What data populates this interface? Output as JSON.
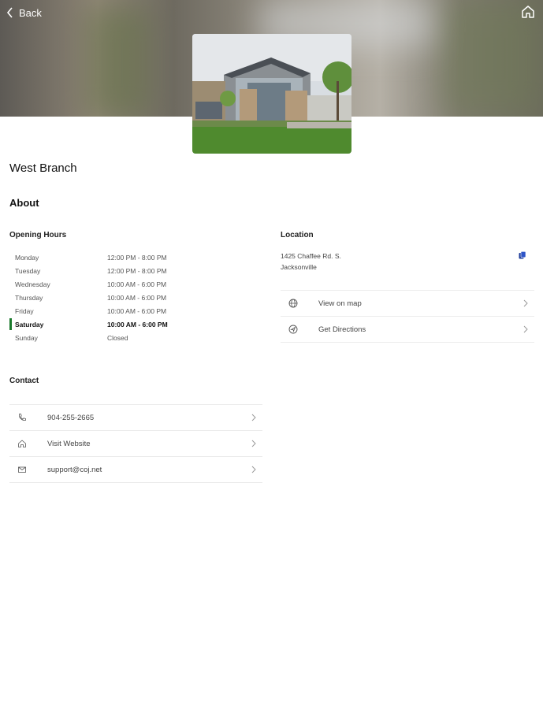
{
  "nav": {
    "back_label": "Back",
    "back_icon": "chevron-left-icon",
    "home_icon": "home-icon"
  },
  "branch": {
    "name": "West Branch"
  },
  "about": {
    "title": "About"
  },
  "opening_hours": {
    "title": "Opening Hours",
    "days": [
      {
        "day": "Monday",
        "time": "12:00 PM - 8:00 PM"
      },
      {
        "day": "Tuesday",
        "time": "12:00 PM - 8:00 PM"
      },
      {
        "day": "Wednesday",
        "time": "10:00 AM - 6:00 PM"
      },
      {
        "day": "Thursday",
        "time": "10:00 AM - 6:00 PM"
      },
      {
        "day": "Friday",
        "time": "10:00 AM - 6:00 PM"
      },
      {
        "day": "Saturday",
        "time": "10:00 AM - 6:00 PM"
      },
      {
        "day": "Sunday",
        "time": "Closed"
      }
    ],
    "today_highlight_color": "#1a7a2c"
  },
  "location": {
    "title": "Location",
    "address_line1": "1425 Chaffee Rd. S.",
    "address_line2": "Jacksonville",
    "copy_icon": "copy-icon",
    "actions": [
      {
        "label": "View on map",
        "icon": "globe-icon"
      },
      {
        "label": "Get Directions",
        "icon": "directions-icon"
      }
    ]
  },
  "contact": {
    "title": "Contact",
    "items": [
      {
        "label": "904-255-2665",
        "icon": "phone-icon"
      },
      {
        "label": "Visit Website",
        "icon": "home-icon"
      },
      {
        "label": "support@coj.net",
        "icon": "mail-icon"
      }
    ]
  }
}
